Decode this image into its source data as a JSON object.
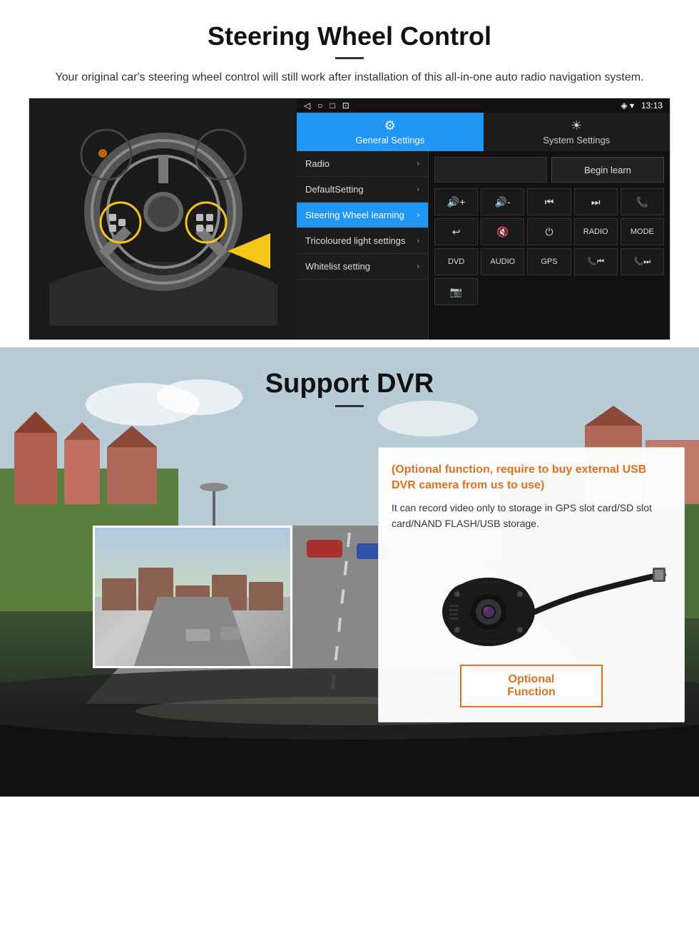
{
  "page": {
    "section1": {
      "title": "Steering Wheel Control",
      "description": "Your original car's steering wheel control will still work after installation of this all-in-one auto radio navigation system.",
      "android_statusbar": {
        "left_icons": "◁  ○  □  ⊡",
        "right_info": "◈ ▾ 13:13"
      },
      "tabs": [
        {
          "label": "General Settings",
          "icon": "⚙",
          "active": true
        },
        {
          "label": "System Settings",
          "icon": "☀",
          "active": false
        }
      ],
      "menu_items": [
        {
          "label": "Radio",
          "active": false
        },
        {
          "label": "DefaultSetting",
          "active": false
        },
        {
          "label": "Steering Wheel learning",
          "active": true
        },
        {
          "label": "Tricoloured light settings",
          "active": false
        },
        {
          "label": "Whitelist setting",
          "active": false
        }
      ],
      "begin_learn": "Begin learn",
      "buttons": [
        "🔊+",
        "🔊-",
        "⏮",
        "⏭",
        "📞",
        "↩",
        "🔇",
        "⏻",
        "RADIO",
        "MODE",
        "DVD",
        "AUDIO",
        "GPS",
        "📞⏮",
        "📞⏭",
        "📷"
      ]
    },
    "section2": {
      "title": "Support DVR",
      "card": {
        "optional_text": "(Optional function, require to buy external USB DVR camera from us to use)",
        "description": "It can record video only to storage in GPS slot card/SD slot card/NAND FLASH/USB storage.",
        "button_label": "Optional Function"
      }
    }
  }
}
